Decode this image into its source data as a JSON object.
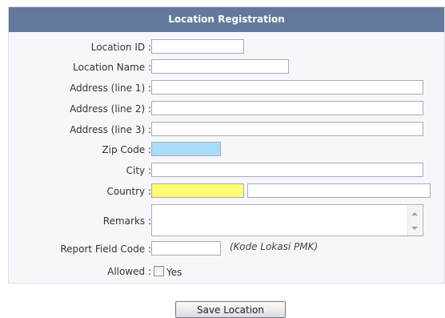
{
  "form": {
    "title": "Location Registration",
    "fields": {
      "location_id": {
        "label": "Location ID :",
        "value": ""
      },
      "location_name": {
        "label": "Location Name :",
        "value": ""
      },
      "address1": {
        "label": "Address (line 1) :",
        "value": ""
      },
      "address2": {
        "label": "Address (line 2) :",
        "value": ""
      },
      "address3": {
        "label": "Address (line 3) :",
        "value": ""
      },
      "zip_code": {
        "label": "Zip Code :",
        "value": "",
        "color": "#a8dcf8"
      },
      "city": {
        "label": "City :",
        "value": ""
      },
      "country": {
        "label": "Country :",
        "code_value": "",
        "name_value": "",
        "color": "#fdfd72"
      },
      "remarks": {
        "label": "Remarks :",
        "value": ""
      },
      "report_field_code": {
        "label": "Report Field Code :",
        "value": "",
        "hint": "(Kode Lokasi PMK)"
      },
      "allowed": {
        "label": "Allowed :",
        "checkbox_label": "Yes",
        "checked": false
      }
    }
  },
  "colors": {
    "header_bg": "#62799b",
    "panel_bg": "#f7f7fb"
  },
  "save_button": {
    "label": "Save Location"
  }
}
